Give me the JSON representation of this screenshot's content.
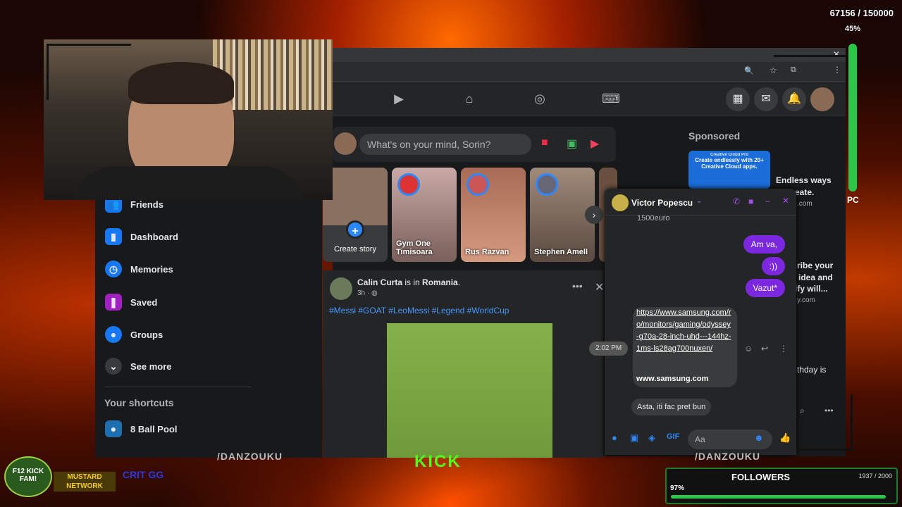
{
  "hud": {
    "progress_counter": "67156 / 150000",
    "progress_percent": "45%",
    "followers_title": "FOLLOWERS",
    "followers_count": "1937 / 2000",
    "followers_percent": "97%",
    "followers_fill": 0.97,
    "handle_left": "/DANZOUKU",
    "handle_right": "/DANZOUKU",
    "kick_text": "KICK",
    "pc_text": "PC"
  },
  "logos": {
    "f12": "F12 KICK FAM!",
    "mustard": "MUSTARD NETWORK",
    "crit": "CRIT GG"
  },
  "sidebar": {
    "items": [
      {
        "label": "Friends",
        "icon": "friends-icon"
      },
      {
        "label": "Dashboard",
        "icon": "dashboard-icon"
      },
      {
        "label": "Memories",
        "icon": "memories-icon"
      },
      {
        "label": "Saved",
        "icon": "saved-icon"
      },
      {
        "label": "Groups",
        "icon": "groups-icon"
      },
      {
        "label": "See more",
        "icon": "chevron-down-icon"
      }
    ],
    "shortcuts_title": "Your shortcuts",
    "shortcuts": [
      {
        "label": "8 Ball Pool"
      }
    ]
  },
  "composer": {
    "placeholder": "What's on your mind, Sorin?"
  },
  "stories": [
    {
      "name": "Create story"
    },
    {
      "name": "Gym One Timisoara"
    },
    {
      "name": "Rus Razvan"
    },
    {
      "name": "Stephen Amell"
    }
  ],
  "post": {
    "author": "Calin Curta",
    "is_in": "is in",
    "location": "Romania",
    "time": "3h",
    "hashtags": "#Messi #GOAT #LeoMessi #Legend #WorldCup"
  },
  "sponsored": {
    "title": "Sponsored",
    "ad1_image_text": "Create endlessly with 20+ Creative Cloud apps.",
    "ad1_brand": "Creative Cloud Pro",
    "ad1_title": "Endless ways",
    "ad1_line2": "eate.",
    "ad1_domain": ".com",
    "ad2_line1": "ribe your",
    "ad2_line2": "idea and",
    "ad2_line3": "ify will...",
    "ad2_domain": "y.com",
    "birthday": "thday is"
  },
  "chat": {
    "name": "Victor Popescu",
    "prev_msg": "1500euro",
    "out1": "Am va,",
    "out2": ":))",
    "out3": "Vazut*",
    "link": "https://www.samsung.com/ro/monitors/gaming/odyssey-g70a-28-inch-uhd---144hz-1ms-ls28ag700nuxen/",
    "link_domain": "www.samsung.com",
    "time": "2:02 PM",
    "last_msg": "Asta, iti fac pret bun",
    "input_placeholder": "Aa"
  },
  "colors": {
    "fb_blue": "#2d88ff",
    "messenger_purple": "#7b28e0",
    "followers_green": "#2ec648"
  }
}
